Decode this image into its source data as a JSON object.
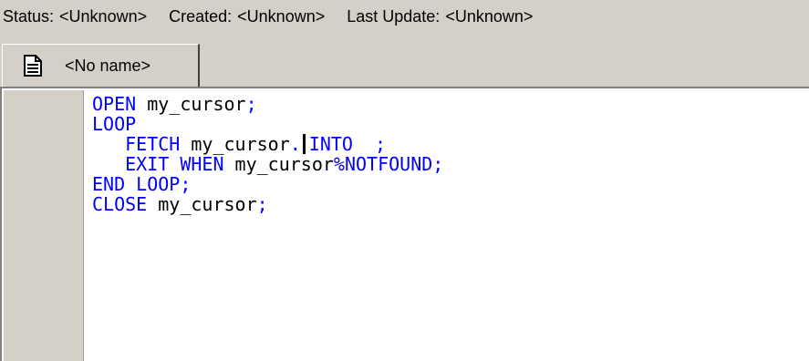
{
  "status_bar": {
    "status_label": "Status:",
    "status_value": "<Unknown>",
    "created_label": "Created:",
    "created_value": "<Unknown>",
    "updated_label": "Last Update:",
    "updated_value": "<Unknown>"
  },
  "tab": {
    "icon": "document-icon",
    "label": "<No name>"
  },
  "editor": {
    "lines": [
      [
        {
          "t": "OPEN",
          "c": "kw"
        },
        {
          "t": " my_cursor",
          "c": "id"
        },
        {
          "t": ";",
          "c": "kw"
        }
      ],
      [
        {
          "t": "LOOP",
          "c": "kw"
        }
      ],
      [
        {
          "t": "   FETCH",
          "c": "kw"
        },
        {
          "t": " my_cursor",
          "c": "id"
        },
        {
          "t": ".",
          "c": "kw"
        },
        {
          "caret": true
        },
        {
          "t": "INTO",
          "c": "kw"
        },
        {
          "t": "  ;",
          "c": "kw"
        }
      ],
      [
        {
          "t": "   EXIT WHEN",
          "c": "kw"
        },
        {
          "t": " my_cursor",
          "c": "id"
        },
        {
          "t": "%NOTFOUND;",
          "c": "kw"
        }
      ],
      [
        {
          "t": "END LOOP;",
          "c": "kw"
        }
      ],
      [
        {
          "t": "CLOSE",
          "c": "kw"
        },
        {
          "t": " my_cursor",
          "c": "id"
        },
        {
          "t": ";",
          "c": "kw"
        }
      ]
    ],
    "colors": {
      "keyword": "#0000ff",
      "identifier": "#000000",
      "background": "#ffffff",
      "gutter": "#d4d0c8"
    }
  }
}
